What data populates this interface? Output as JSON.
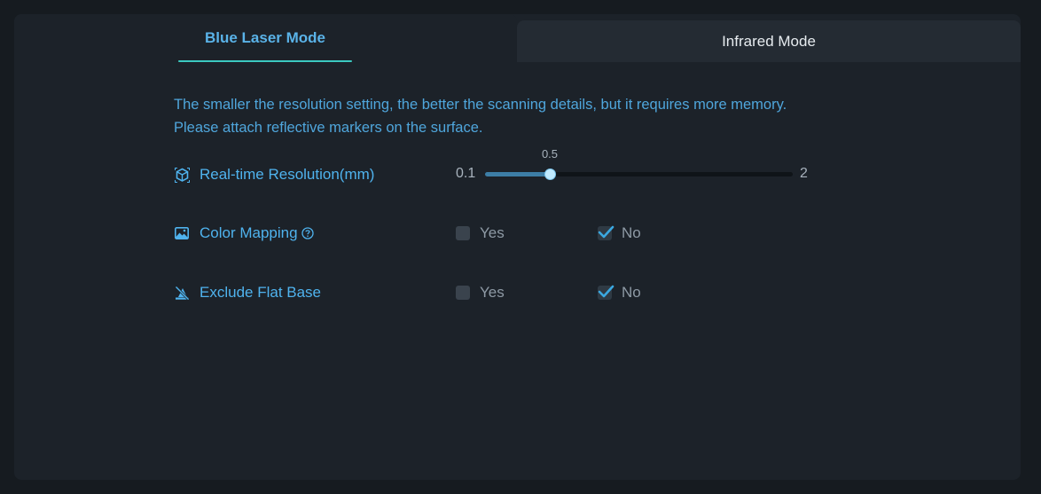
{
  "tabs": {
    "active_label": "Blue Laser Mode",
    "inactive_label": "Infrared Mode"
  },
  "info": {
    "line1": "The smaller the resolution setting, the better the scanning details, but it requires more memory.",
    "line2": "Please attach reflective markers on the surface."
  },
  "resolution": {
    "label": "Real-time Resolution(mm)",
    "min_label": "0.1",
    "max_label": "2",
    "value_label": "0.5",
    "min": 0.1,
    "max": 2,
    "value": 0.5,
    "icon": "cube-scan-icon"
  },
  "color_mapping": {
    "label": "Color Mapping",
    "icon": "image-icon",
    "help_icon": "help-icon",
    "yes_label": "Yes",
    "no_label": "No",
    "selected": "No"
  },
  "exclude_flat_base": {
    "label": "Exclude Flat Base",
    "icon": "exclude-base-icon",
    "yes_label": "Yes",
    "no_label": "No",
    "selected": "No"
  },
  "colors": {
    "accent": "#4fb3ee",
    "tab_underline": "#3bc9c0",
    "check": "#3ba8e0"
  }
}
